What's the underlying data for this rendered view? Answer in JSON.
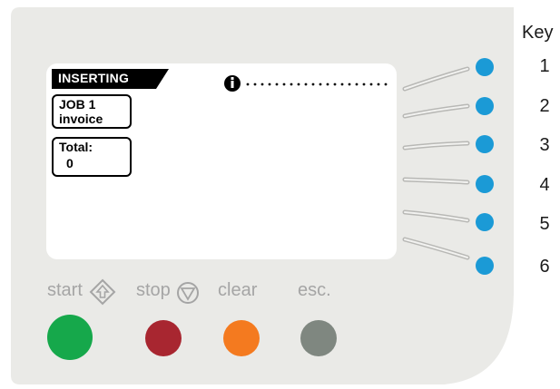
{
  "display": {
    "status": "INSERTING",
    "job_line1": "JOB  1",
    "job_line2": "invoice",
    "total_label": "Total:",
    "total_value": "0",
    "info_icon": "info-icon"
  },
  "controls": {
    "start_label": "start",
    "stop_label": "stop",
    "clear_label": "clear",
    "esc_label": "esc.",
    "start_icon": "diamond-arrow-icon",
    "stop_icon": "circle-triangle-icon"
  },
  "key": {
    "title": "Key",
    "numbers": [
      "1",
      "2",
      "3",
      "4",
      "5",
      "6"
    ]
  },
  "colors": {
    "panel": "#eaeae7",
    "screen": "#ffffff",
    "soft_key": "#1b9ad6",
    "start": "#16a84b",
    "stop": "#a82630",
    "clear": "#f47a1f",
    "esc": "#7f8780",
    "label_grey": "#a5a5a5"
  }
}
